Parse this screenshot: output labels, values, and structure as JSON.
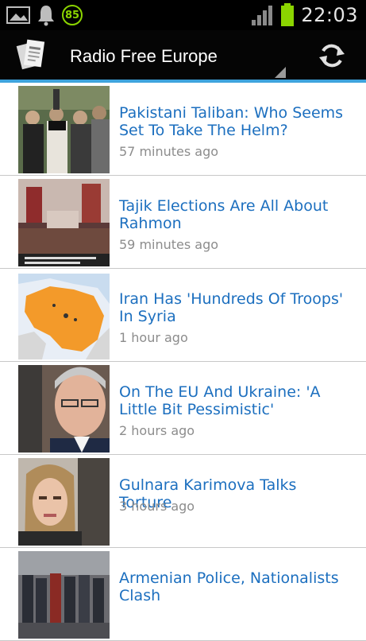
{
  "status_bar": {
    "time": "22:03",
    "notification_badge": "85",
    "icons": [
      "image-icon",
      "bell-icon",
      "signal-icon",
      "battery-icon"
    ],
    "battery_color": "#8bd400"
  },
  "action_bar": {
    "title": "Radio Free Europe",
    "accent_color": "#3ea3dc",
    "refresh_icon": "refresh-icon"
  },
  "articles": [
    {
      "headline": "Pakistani Taliban: Who Seems Set To Take The Helm?",
      "time": "57 minutes ago"
    },
    {
      "headline": "Tajik Elections Are All About Rahmon",
      "time": "59 minutes ago"
    },
    {
      "headline": "Iran Has 'Hundreds Of Troops' In Syria",
      "time": "1 hour ago"
    },
    {
      "headline": "On The EU And Ukraine: 'A Little Bit Pessimistic'",
      "time": "2 hours ago"
    },
    {
      "headline": "Gulnara Karimova Talks Torture",
      "time": "3 hours ago"
    },
    {
      "headline": "Armenian Police, Nationalists Clash",
      "time": ""
    }
  ],
  "colors": {
    "headline": "#1c6fbf",
    "timestamp": "#8c8c8c"
  }
}
